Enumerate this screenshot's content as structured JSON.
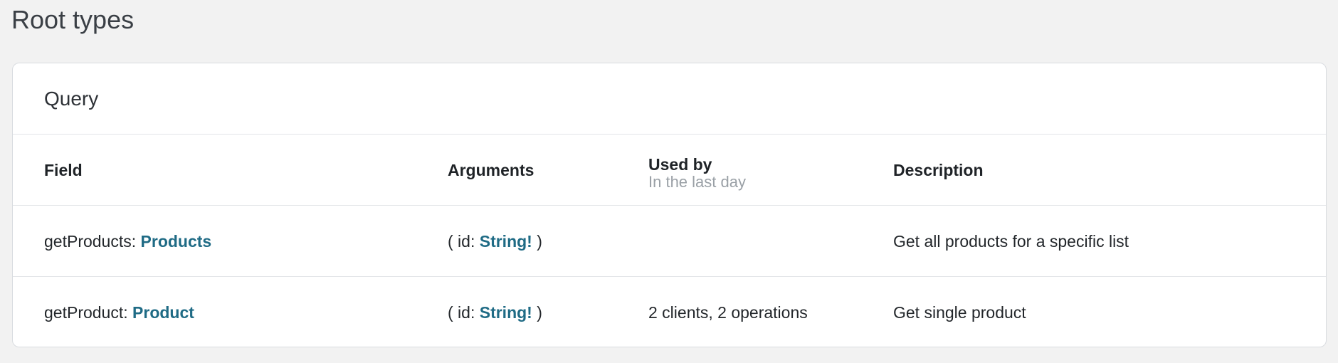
{
  "page": {
    "title": "Root types"
  },
  "card": {
    "title": "Query",
    "columns": {
      "field": "Field",
      "arguments": "Arguments",
      "used_by": "Used by",
      "used_by_sub": "In the last day",
      "description": "Description"
    },
    "rows": [
      {
        "field_name": "getProducts: ",
        "field_type": "Products",
        "args_open": "( id: ",
        "args_type": "String!",
        "args_close": " )",
        "used_by": "",
        "description": "Get all products for a specific list"
      },
      {
        "field_name": "getProduct: ",
        "field_type": "Product",
        "args_open": "( id: ",
        "args_type": "String!",
        "args_close": " )",
        "used_by": "2 clients, 2 operations",
        "description": "Get single product"
      }
    ]
  },
  "colors": {
    "background": "#f2f2f2",
    "card": "#ffffff",
    "link": "#1f6b85",
    "muted": "#9aa0a6"
  }
}
